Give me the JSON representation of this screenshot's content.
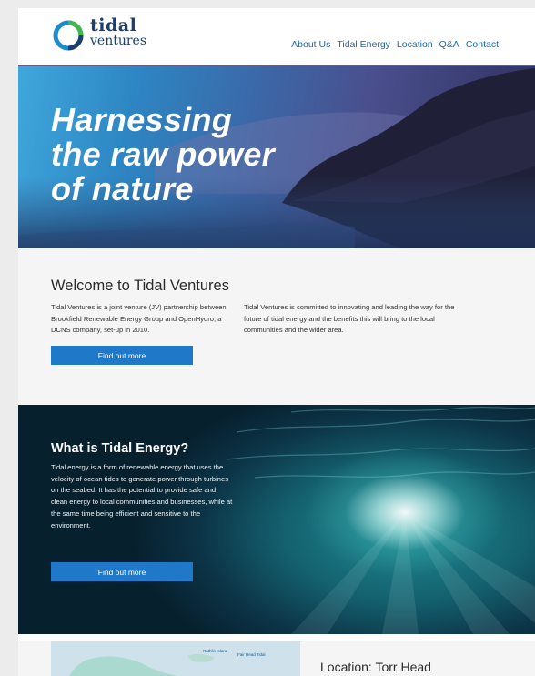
{
  "brand": {
    "name_line1": "tidal",
    "name_line2": "ventures"
  },
  "nav": {
    "items": [
      {
        "label": "About Us"
      },
      {
        "label": "Tidal Energy"
      },
      {
        "label": "Location"
      },
      {
        "label": "Q&A"
      },
      {
        "label": "Contact"
      }
    ]
  },
  "hero": {
    "title_line1": "Harnessing",
    "title_line2": "the raw power",
    "title_line3": "of nature"
  },
  "welcome": {
    "heading": "Welcome to Tidal Ventures",
    "col1": "Tidal Ventures is a joint venture (JV) partnership between Brookfield Renewable Energy Group and OpenHydro, a DCNS company, set-up in 2010.",
    "col2": "Tidal Ventures is committed to innovating and leading the way for the future of tidal energy and the benefits this will bring to the local communities and the wider area.",
    "button_label": "Find out more"
  },
  "energy": {
    "heading": "What is Tidal Energy?",
    "body": "Tidal energy is a form of renewable energy that uses the velocity of ocean tides to generate power through turbines on the seabed. It has the potential to provide safe and clean energy to local communities and businesses, while at the same time being efficient and sensitive to the environment.",
    "button_label": "Find out more"
  },
  "location": {
    "heading": "Location: Torr Head",
    "map_label_1": "Rathlin Island",
    "map_label_2": "Fair Head Tidal"
  },
  "colors": {
    "brand_navy": "#1d3f6e",
    "nav_link": "#1d6aa8",
    "button_blue": "#1f78c8",
    "nav_rule": "#5a5ea2"
  }
}
